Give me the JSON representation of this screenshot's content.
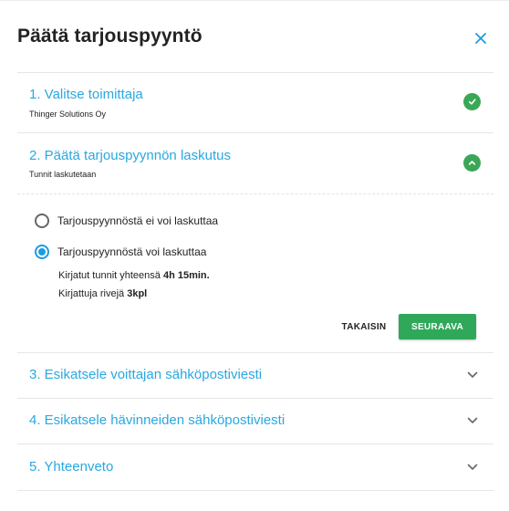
{
  "dialog": {
    "title": "Päätä tarjouspyyntö",
    "close_icon": "close-icon"
  },
  "steps": [
    {
      "label": "1. Valitse toimittaja",
      "subtitle": "Thinger Solutions Oy",
      "state": "completed",
      "icon": "check-circle-icon"
    },
    {
      "label": "2. Päätä tarjouspyynnön laskutus",
      "subtitle": "Tunnit laskutetaan",
      "state": "expanded",
      "icon": "chevron-up-circle-icon"
    },
    {
      "label": "3. Esikatsele voittajan sähköpostiviesti",
      "state": "collapsed",
      "icon": "chevron-down-icon"
    },
    {
      "label": "4. Esikatsele hävinneiden sähköpostiviesti",
      "state": "collapsed",
      "icon": "chevron-down-icon"
    },
    {
      "label": "5. Yhteenveto",
      "state": "collapsed",
      "icon": "chevron-down-icon"
    }
  ],
  "billing": {
    "options": [
      {
        "label": "Tarjouspyynnöstä ei voi laskuttaa",
        "selected": false
      },
      {
        "label": "Tarjouspyynnöstä voi laskuttaa",
        "selected": true
      }
    ],
    "hours_prefix": "Kirjatut tunnit yhteensä ",
    "hours_value": "4h 15min.",
    "rows_prefix": "Kirjattuja rivejä ",
    "rows_value": "3kpl"
  },
  "actions": {
    "back_label": "TAKAISIN",
    "next_label": "SEURAAVA"
  },
  "colors": {
    "accent_blue": "#29a8e0",
    "success_green": "#3aa757",
    "button_green": "#2fa85a"
  }
}
